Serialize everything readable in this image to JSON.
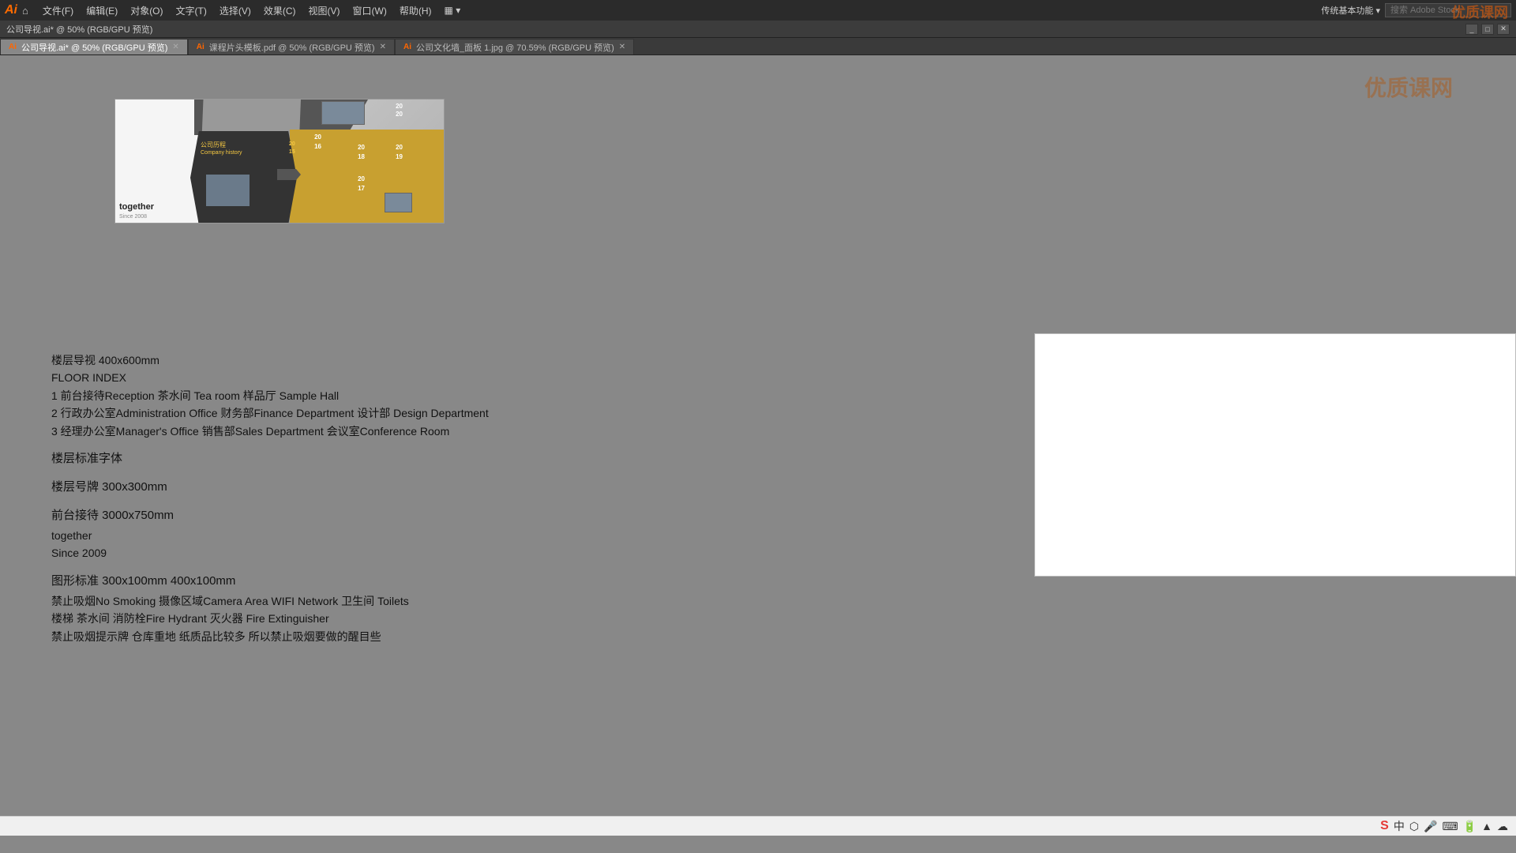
{
  "app": {
    "logo": "Ai",
    "title": "公司导视.ai* @ 50% (RGB/GPU 预览)"
  },
  "menubar": {
    "items": [
      "文件(F)",
      "编辑(E)",
      "对象(O)",
      "文字(T)",
      "选择(V)",
      "效果(C)",
      "视图(V)",
      "窗口(W)",
      "帮助(H)"
    ],
    "view_mode": "▦ ▾",
    "right_text": "传统基本功能 ▾",
    "search_placeholder": "搜索 Adobe Stock"
  },
  "tabs": [
    {
      "label": "公司导视.ai* @ 50% (RGB/GPU 预览)",
      "active": true
    },
    {
      "label": "课程片头模板.pdf @ 50% (RGB/GPU 预览)",
      "active": false
    },
    {
      "label": "公司文化墙_面板 1.jpg @ 70.59% (RGB/GPU 预览)",
      "active": false
    }
  ],
  "design": {
    "together_text": "together",
    "since_text": "Since 2008",
    "company_cn": "公司历程",
    "company_en": "Company history",
    "years": [
      "2020",
      "2016",
      "2018",
      "2019",
      "2015",
      "2017"
    ]
  },
  "content": {
    "line1": "楼层导视 400x600mm",
    "line2": "FLOOR INDEX",
    "line3": "1  前台接待Reception  茶水间 Tea room 样品厅 Sample Hall",
    "line4": "2 行政办公室Administration Office 财务部Finance Department 设计部 Design Department",
    "line5": "3 经理办公室Manager's Office 销售部Sales Department 会议室Conference Room",
    "label1": "楼层标准字体",
    "label2": "楼层号牌 300x300mm",
    "label3": "前台接待 3000x750mm",
    "label3_sub1": "together",
    "label3_sub2": "Since 2009",
    "label4": "图形标准 300x100mm  400x100mm",
    "label4_sub1": "禁止吸烟No Smoking 摄像区域Camera Area WIFI Network 卫生间 Toilets",
    "label4_sub2": "楼梯 茶水间 消防栓Fire Hydrant 灭火器 Fire Extinguisher",
    "label4_sub3": "禁止吸烟提示牌 仓库重地 纸质品比较多 所以禁止吸烟要做的醒目些"
  },
  "watermark": {
    "text": "优质课网"
  }
}
